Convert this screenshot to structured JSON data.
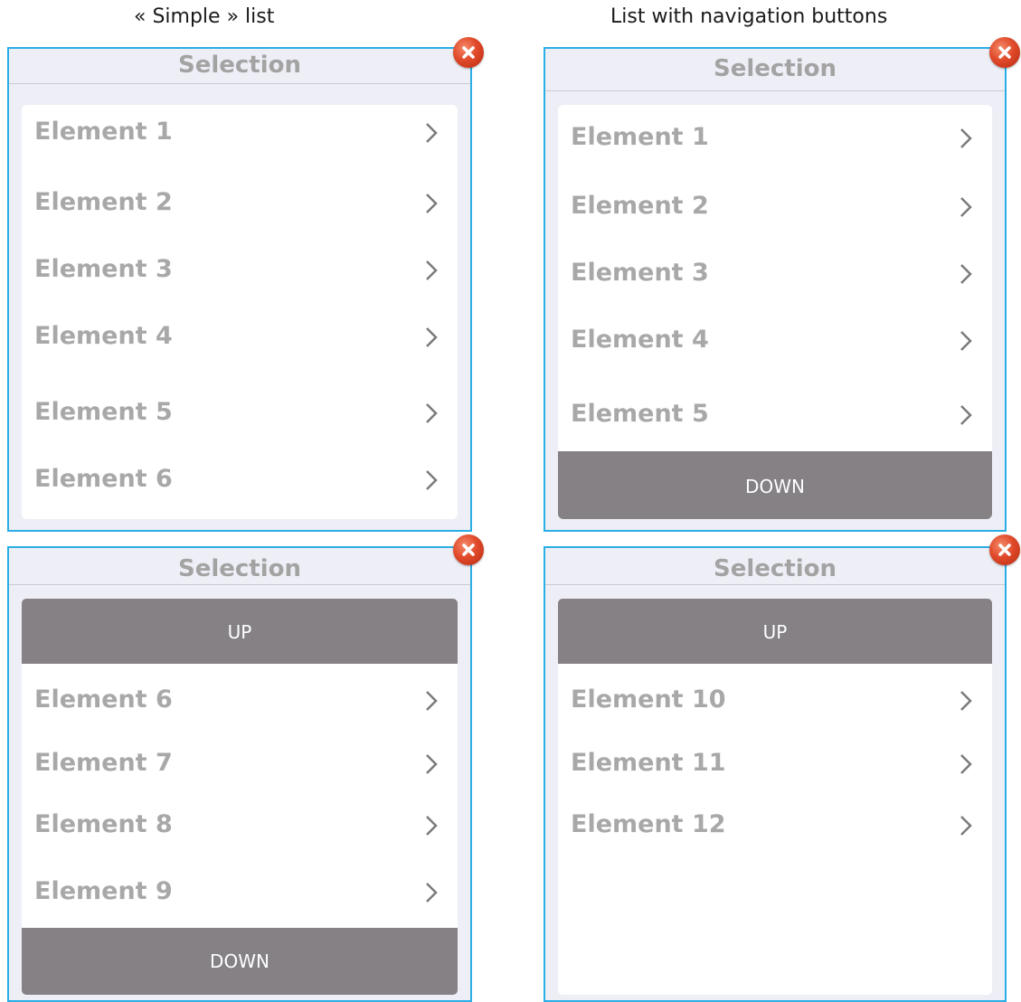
{
  "captions": {
    "simple": "« Simple » list",
    "navigation": "List with navigation buttons"
  },
  "panels": [
    {
      "title": "Selection",
      "up_label": null,
      "down_label": null,
      "items": [
        "Element 1",
        "Element 2",
        "Element 3",
        "Element 4",
        "Element 5",
        "Element 6"
      ]
    },
    {
      "title": "Selection",
      "up_label": null,
      "down_label": "DOWN",
      "items": [
        "Element 1",
        "Element 2",
        "Element 3",
        "Element 4",
        "Element 5"
      ]
    },
    {
      "title": "Selection",
      "up_label": "UP",
      "down_label": "DOWN",
      "items": [
        "Element 6",
        "Element 7",
        "Element 8",
        "Element 9"
      ]
    },
    {
      "title": "Selection",
      "up_label": "UP",
      "down_label": null,
      "items": [
        "Element 10",
        "Element 11",
        "Element 12"
      ]
    }
  ],
  "icons": {
    "close": "close-icon",
    "chevron": "chevron-right-icon"
  },
  "colors": {
    "panel_border": "#29aee6",
    "panel_bg": "#eeeff6",
    "nav_button": "#858185",
    "item_text": "#a8a8a8",
    "close_red": "#e04a2a"
  }
}
